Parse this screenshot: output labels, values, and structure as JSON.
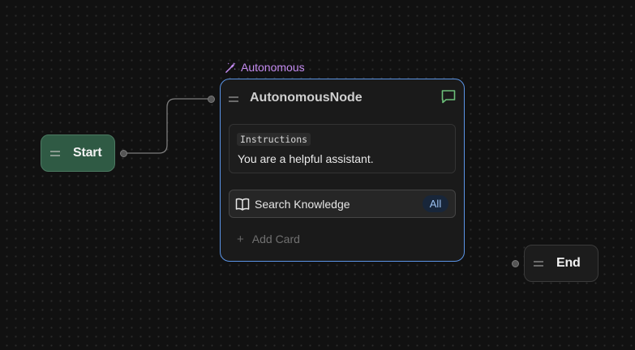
{
  "nodes": {
    "start": {
      "title": "Start"
    },
    "autonomous": {
      "badge": "Autonomous",
      "title": "AutonomousNode",
      "instructions": {
        "tag": "Instructions",
        "text": "You are a helpful assistant."
      },
      "cards": [
        {
          "icon": "book-icon",
          "label": "Search Knowledge",
          "badge": "All"
        }
      ],
      "add_card_label": "Add Card"
    },
    "end": {
      "title": "End"
    }
  },
  "colors": {
    "background": "#111111",
    "start_fill": "#2f5a44",
    "selected_border": "#5b94e6",
    "badge_purple": "#c48bf0",
    "chat_icon": "#6cc07a"
  },
  "icons": {
    "badge": "magic-wand-icon",
    "chat": "chat-bubble-icon",
    "drag": "drag-handle-icon",
    "add": "plus-icon"
  }
}
